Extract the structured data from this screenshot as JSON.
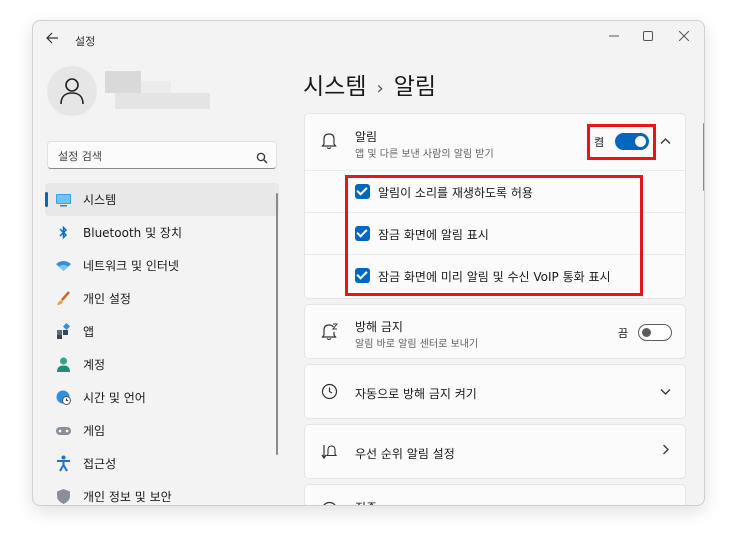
{
  "window": {
    "title": "설정",
    "back_icon": "back-arrow-icon",
    "controls": [
      "minimize-icon",
      "maximize-icon",
      "close-icon"
    ]
  },
  "search": {
    "placeholder": "설정 검색"
  },
  "sidebar": {
    "items": [
      {
        "label": "시스템",
        "icon": "monitor-icon",
        "active": true
      },
      {
        "label": "Bluetooth 및 장치",
        "icon": "bluetooth-icon",
        "active": false
      },
      {
        "label": "네트워크 및 인터넷",
        "icon": "wifi-icon",
        "active": false
      },
      {
        "label": "개인 설정",
        "icon": "brush-icon",
        "active": false
      },
      {
        "label": "앱",
        "icon": "apps-icon",
        "active": false
      },
      {
        "label": "계정",
        "icon": "person-icon",
        "active": false
      },
      {
        "label": "시간 및 언어",
        "icon": "globe-clock-icon",
        "active": false
      },
      {
        "label": "게임",
        "icon": "gamepad-icon",
        "active": false
      },
      {
        "label": "접근성",
        "icon": "accessibility-icon",
        "active": false
      },
      {
        "label": "개인 정보 및 보안",
        "icon": "shield-icon",
        "active": false
      }
    ]
  },
  "breadcrumb": {
    "parent": "시스템",
    "separator": "›",
    "current": "알림"
  },
  "notifications": {
    "title": "알림",
    "subtitle": "앱 및 다른 보낸 사람의 알림 받기",
    "toggle_label": "켬",
    "toggle_on": true,
    "options": [
      {
        "label": "알림이 소리를 재생하도록 허용",
        "checked": true
      },
      {
        "label": "잠금 화면에 알림 표시",
        "checked": true
      },
      {
        "label": "잠금 화면에 미리 알림 및 수신 VoIP 통화 표시",
        "checked": true
      }
    ]
  },
  "dnd": {
    "title": "방해 금지",
    "subtitle": "알림 바로 알림 센터로 보내기",
    "toggle_label": "끔",
    "toggle_on": false
  },
  "auto_dnd": {
    "title": "자동으로 방해 금지 켜기"
  },
  "priority": {
    "title": "우선 순위 알림 설정"
  },
  "focus": {
    "title": "집중"
  },
  "colors": {
    "accent": "#0067c0",
    "highlight": "#e8141a"
  }
}
